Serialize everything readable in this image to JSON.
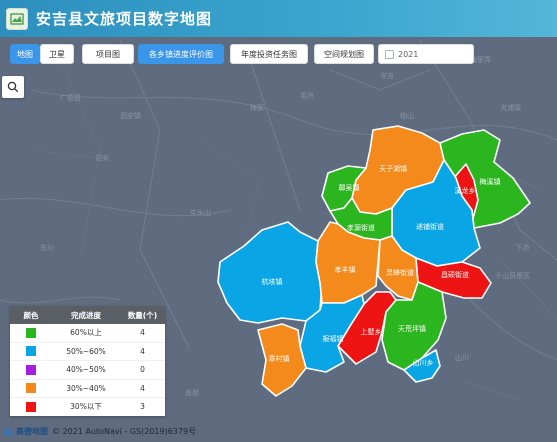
{
  "header": {
    "title": "安吉县文旅项目数字地图"
  },
  "toolbar": {
    "map_tab": "地图",
    "satellite_tab": "卫星",
    "buttons": [
      "项目图",
      "各乡镇进度评价图",
      "年度投资任务图",
      "空间规划图"
    ],
    "year": "2021"
  },
  "map": {
    "colors": {
      "green": "#2bb51f",
      "blue": "#0aa5e5",
      "purple": "#a61ee3",
      "orange": "#f58a1c",
      "red": "#ee1414"
    },
    "regions": [
      {
        "name": "天子湖镇",
        "level": "orange"
      },
      {
        "name": "鄣吴镇",
        "level": "green"
      },
      {
        "name": "梅溪镇",
        "level": "green"
      },
      {
        "name": "溪龙乡",
        "level": "red"
      },
      {
        "name": "孝源街道",
        "level": "green"
      },
      {
        "name": "递铺街道",
        "level": "blue"
      },
      {
        "name": "杭垓镇",
        "level": "blue"
      },
      {
        "name": "孝丰镇",
        "level": "orange"
      },
      {
        "name": "灵峰街道",
        "level": "orange"
      },
      {
        "name": "昌硕街道",
        "level": "red"
      },
      {
        "name": "天荒坪镇",
        "level": "green"
      },
      {
        "name": "报福镇",
        "level": "blue"
      },
      {
        "name": "上墅乡",
        "level": "red"
      },
      {
        "name": "章村镇",
        "level": "orange"
      },
      {
        "name": "山川乡",
        "level": "blue"
      }
    ],
    "background_labels": [
      "泗安镇",
      "梅家弄",
      "夹浦镇",
      "广德县",
      "泗安",
      "梅家",
      "毛坞",
      "柏山",
      "东川",
      "牛头山",
      "安吉",
      "下汤",
      "胡家",
      "千山风景区",
      "良朋",
      "山川"
    ]
  },
  "legend": {
    "headers": [
      "颜色",
      "完成进度",
      "数量(个)"
    ],
    "rows": [
      {
        "color": "#2bb51f",
        "label": "60%以上",
        "count": "4"
      },
      {
        "color": "#0aa5e5",
        "label": "50%~60%",
        "count": "4"
      },
      {
        "color": "#a61ee3",
        "label": "40%~50%",
        "count": "0"
      },
      {
        "color": "#f58a1c",
        "label": "30%~40%",
        "count": "4"
      },
      {
        "color": "#ee1414",
        "label": "30%以下",
        "count": "3"
      }
    ]
  },
  "footer": {
    "brand": "高德地图",
    "copyright": "© 2021 AutoNavi - GS(2019)6379号"
  }
}
